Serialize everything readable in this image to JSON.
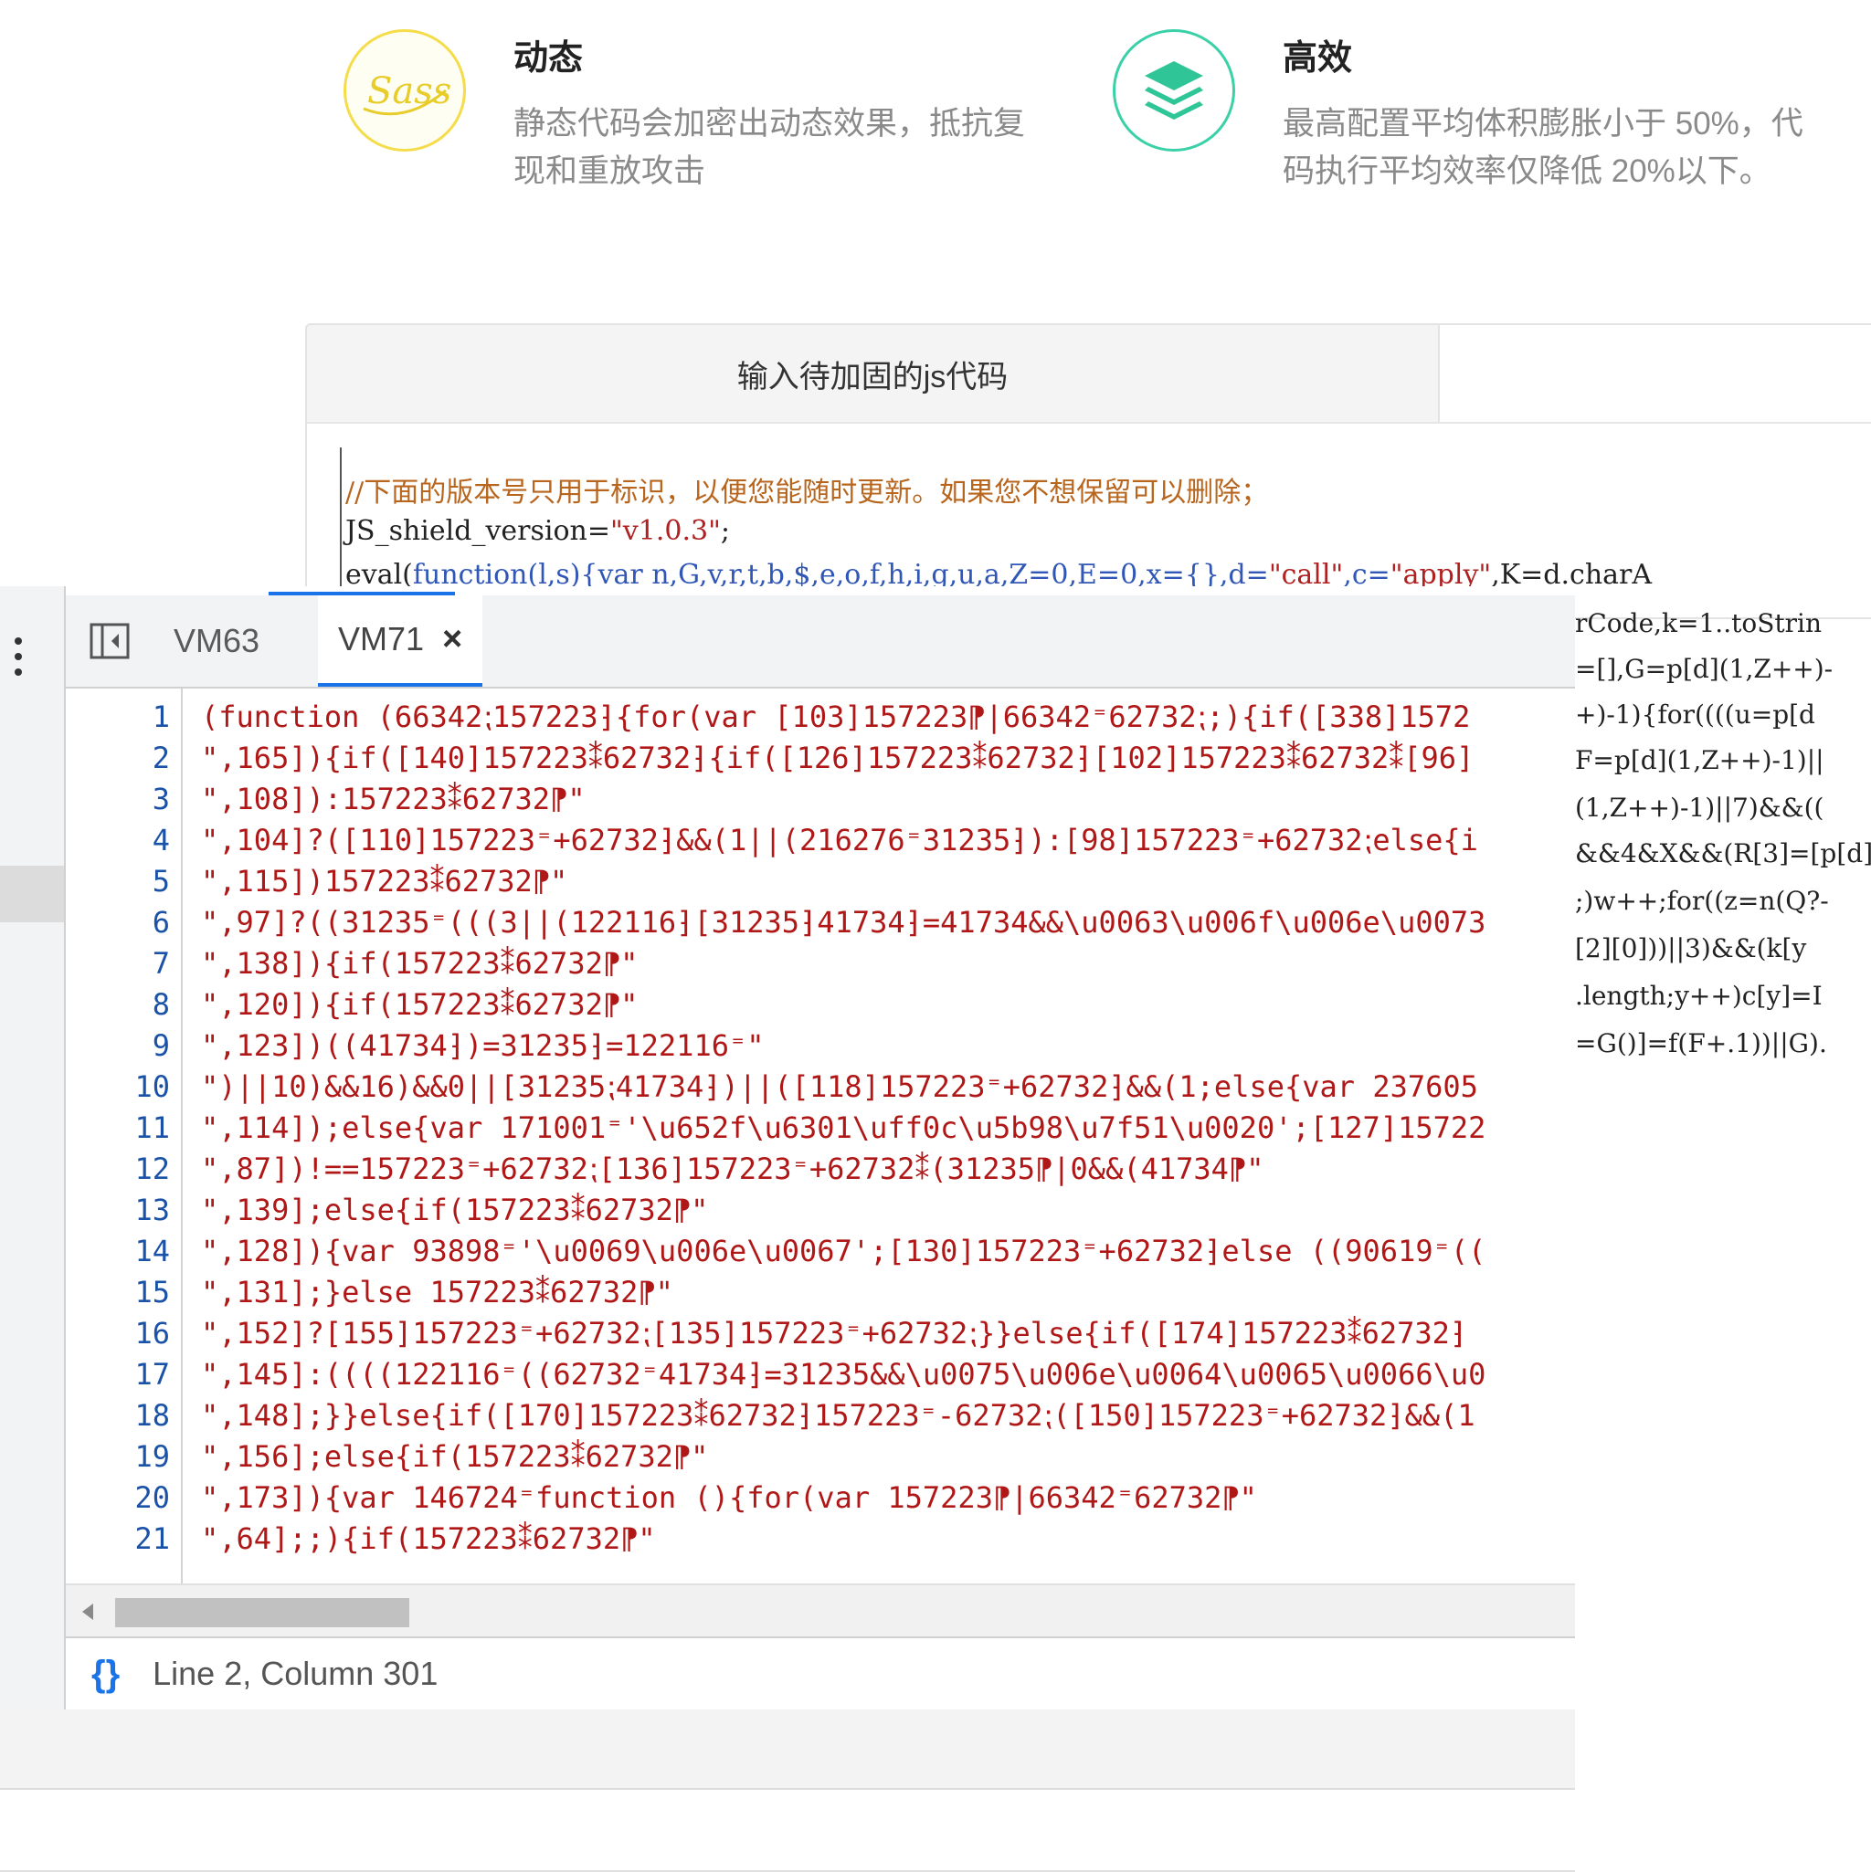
{
  "features": [
    {
      "title": "动态",
      "desc": "静态代码会加密出动态效果，抵抗复现和重放攻击",
      "icon": "sass-icon"
    },
    {
      "title": "高效",
      "desc": "最高配置平均体积膨胀小于 50%，代码执行平均效率仅降低 20%以下。",
      "icon": "layers-icon"
    }
  ],
  "panel": {
    "tab_input": "输入待加固的js代码",
    "code": {
      "comment": "//下面的版本号只用于标识，以便您能随时更新。如果您不想保留可以删除；",
      "line2_id": "JS_shield_version=",
      "line2_str": "\"v1.0.3\"",
      "line2_end": ";",
      "line3_a": "eval(",
      "line3_kw": "function",
      "line3_b": "(l,s){var n,G,v,r,t,b,$,e,o,f,h,i,g,u,a,Z=0,E=0,x={},d=",
      "line3_str1": "\"call\"",
      "line3_c": ",c=",
      "line3_str2": "\"apply\"",
      "line3_d": ",K=d.charA"
    },
    "right_overflow": [
      "rCode,k=1..toStrin",
      "=[],G=p[d](1,Z++)-",
      "+)-1){for((((u=p[d",
      "F=p[d](1,Z++)-1)||",
      "(1,Z++)-1)||7)&&((",
      "&&4&X&&(R[3]=[p[d]",
      ";)w++;for((z=n(Q?-",
      "[2][0]))||3)&&(k[y",
      ".length;y++)c[y]=I",
      "=G()]=f(F+.1))||G)."
    ]
  },
  "devtools": {
    "tabs": [
      {
        "label": "VM63",
        "active": false
      },
      {
        "label": "VM71",
        "active": true
      }
    ],
    "close_glyph": "×",
    "lines": [
      {
        "n": "1",
        "t": "(function (66342⁏157223⁆{for(var [103]157223⁋|66342⁼62732⁏;){if([338]1572"
      },
      {
        "n": "2",
        "t": "\",165]){if([140]157223⁑62732⁆{if([126]157223⁑62732⁆[102]157223⁑62732⁑[96]"
      },
      {
        "n": "3",
        "t": "\",108]):157223⁑62732⁋\""
      },
      {
        "n": "4",
        "t": "\",104]?([110]157223⁼+62732⁆&&(1||(216276⁼31235⁆):[98]157223⁼+62732⁏else{i"
      },
      {
        "n": "5",
        "t": "\",115])157223⁑62732⁋\""
      },
      {
        "n": "6",
        "t": "\",97]?((31235⁼(((3||(122116⁆[31235⁆41734⁆=41734&&\\u0063\\u006f\\u006e\\u0073"
      },
      {
        "n": "7",
        "t": "\",138]){if(157223⁑62732⁋\""
      },
      {
        "n": "8",
        "t": "\",120]){if(157223⁑62732⁋\""
      },
      {
        "n": "9",
        "t": "\",123])((41734⁆)=31235⁆=122116⁼\""
      },
      {
        "n": "10",
        "t": "\")||10)&&16)&&0||[31235⁏41734⁆)||([118]157223⁼+62732⁆&&(1;else{var 237605"
      },
      {
        "n": "11",
        "t": "\",114]);else{var 171001⁼'\\u652f\\u6301\\uff0c\\u5b98\\u7f51\\u0020';[127]15722"
      },
      {
        "n": "12",
        "t": "\",87])!==157223⁼+62732⁏[136]157223⁼+62732⁑(31235⁋|0&&(41734⁋\""
      },
      {
        "n": "13",
        "t": "\",139];else{if(157223⁑62732⁋\""
      },
      {
        "n": "14",
        "t": "\",128]){var 93898⁼'\\u0069\\u006e\\u0067';[130]157223⁼+62732⁆else ((90619⁼(("
      },
      {
        "n": "15",
        "t": "\",131];}else 157223⁑62732⁋\""
      },
      {
        "n": "16",
        "t": "\",152]?[155]157223⁼+62732⁏[135]157223⁼+62732⁏}}else{if([174]157223⁑62732⁆"
      },
      {
        "n": "17",
        "t": "\",145]:((((122116⁼((62732⁼41734⁆=31235&&\\u0075\\u006e\\u0064\\u0065\\u0066\\u0"
      },
      {
        "n": "18",
        "t": "\",148];}}else{if([170]157223⁑62732⁆157223⁼-62732⁏([150]157223⁼+62732⁆&&(1"
      },
      {
        "n": "19",
        "t": "\",156];else{if(157223⁑62732⁋\""
      },
      {
        "n": "20",
        "t": "\",173]){var 146724⁼function (){for(var 157223⁋|66342⁼62732⁋\""
      },
      {
        "n": "21",
        "t": "\",64];;){if(157223⁑62732⁋\""
      }
    ],
    "status_icon": "{}",
    "status_text": "Line 2, Column 301"
  }
}
